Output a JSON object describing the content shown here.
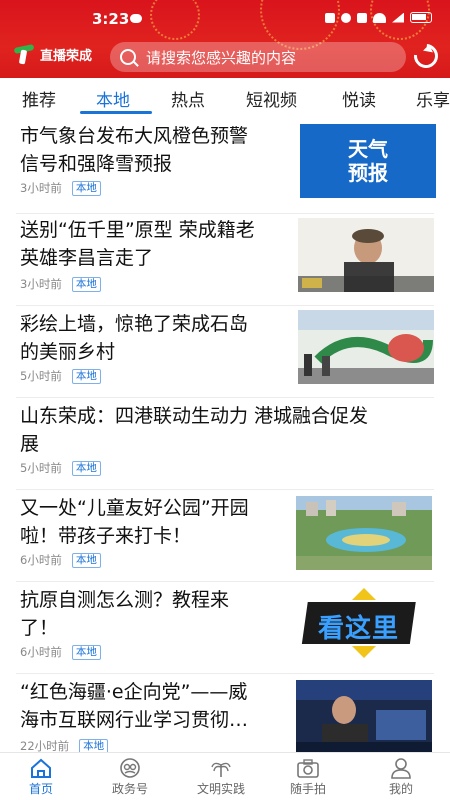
{
  "status": {
    "time": "3:23"
  },
  "header": {
    "app_name": "直播荣成",
    "search_placeholder": "请搜索您感兴趣的内容"
  },
  "tabs": [
    "推荐",
    "本地",
    "热点",
    "短视频",
    "悦读",
    "乐享"
  ],
  "active_tab": "本地",
  "feed": [
    {
      "title_l1": "市气象台发布大风橙色预警",
      "title_l2": "信号和强降雪预报",
      "time": "3小时前",
      "tag": "本地",
      "thumb": "天气\n预报"
    },
    {
      "title_l1": "送别“伍千里”原型 荣成籍老",
      "title_l2": "英雄李昌言走了",
      "time": "3小时前",
      "tag": "本地"
    },
    {
      "title_l1": "彩绘上墙，惊艳了荣成石岛",
      "title_l2": "的美丽乡村",
      "time": "5小时前",
      "tag": "本地"
    },
    {
      "title_l1": "山东荣成：四港联动生动力 港城融合促发",
      "title_l2": "展",
      "time": "5小时前",
      "tag": "本地"
    },
    {
      "title_l1": "又一处“儿童友好公园”开园",
      "title_l2": "啦！带孩子来打卡！",
      "time": "6小时前",
      "tag": "本地"
    },
    {
      "title_l1": "抗原自测怎么测？教程来",
      "title_l2": "了！",
      "time": "6小时前",
      "tag": "本地",
      "thumb": "看这里"
    },
    {
      "title_l1": "“红色海疆·e企向党”——威",
      "title_l2": "海市互联网行业学习贯彻…",
      "time": "22小时前",
      "tag": "本地"
    }
  ],
  "bottom_nav": [
    "首页",
    "政务号",
    "文明实践",
    "随手拍",
    "我的"
  ],
  "colors": {
    "accent": "#1a73d9",
    "header_red": "#d9141c"
  }
}
